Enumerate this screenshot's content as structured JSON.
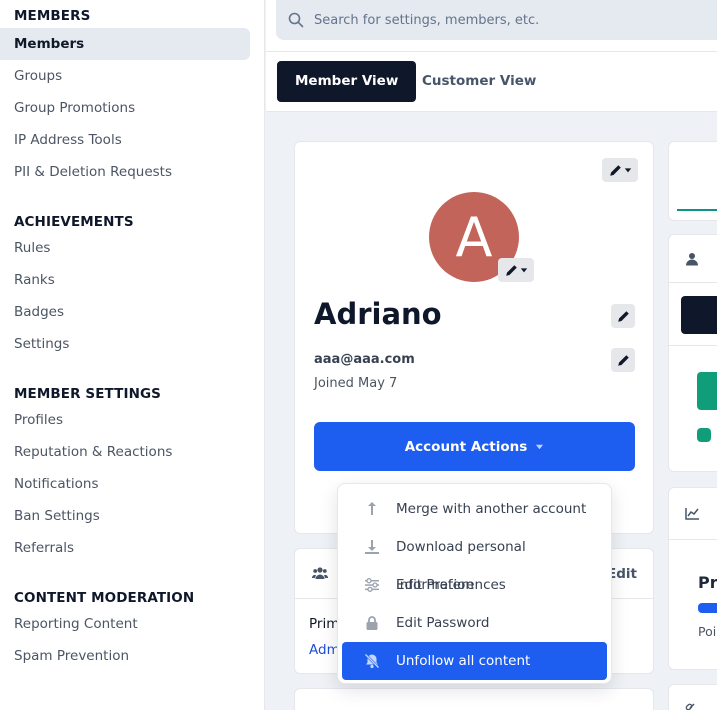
{
  "sidebar": {
    "sections": [
      {
        "title": "MEMBERS",
        "items": [
          "Members",
          "Groups",
          "Group Promotions",
          "IP Address Tools",
          "PII & Deletion Requests"
        ]
      },
      {
        "title": "ACHIEVEMENTS",
        "items": [
          "Rules",
          "Ranks",
          "Badges",
          "Settings"
        ]
      },
      {
        "title": "MEMBER SETTINGS",
        "items": [
          "Profiles",
          "Reputation & Reactions",
          "Notifications",
          "Ban Settings",
          "Referrals"
        ]
      },
      {
        "title": "CONTENT MODERATION",
        "items": [
          "Reporting Content",
          "Spam Prevention"
        ]
      }
    ]
  },
  "search": {
    "placeholder": "Search for settings, members, etc."
  },
  "tabs": {
    "member_view": "Member View",
    "customer_view": "Customer View"
  },
  "profile": {
    "avatar_letter": "A",
    "name": "Adriano",
    "email": "aaa@aaa.com",
    "joined": "Joined May 7",
    "actions_label": "Account Actions"
  },
  "dropdown": {
    "items": [
      {
        "label": "Merge with another account",
        "icon": "merge-arrow-icon"
      },
      {
        "label": "Download personal information",
        "icon": "download-icon"
      },
      {
        "label": "Edit Preferences",
        "icon": "sliders-icon"
      },
      {
        "label": "Edit Password",
        "icon": "lock-icon"
      },
      {
        "label": "Unfollow all content",
        "icon": "bell-slash-icon"
      }
    ]
  },
  "groups_card": {
    "edit_label": "Edit",
    "primary_label": "Prim",
    "admin_label": "Adm"
  },
  "right_panel": {
    "progress_label": "Pre",
    "points_label": "Poi"
  },
  "colors": {
    "primary": "#1d5df0",
    "dark": "#0f172a",
    "avatar": "#c26459",
    "success": "#0f9d7a"
  }
}
